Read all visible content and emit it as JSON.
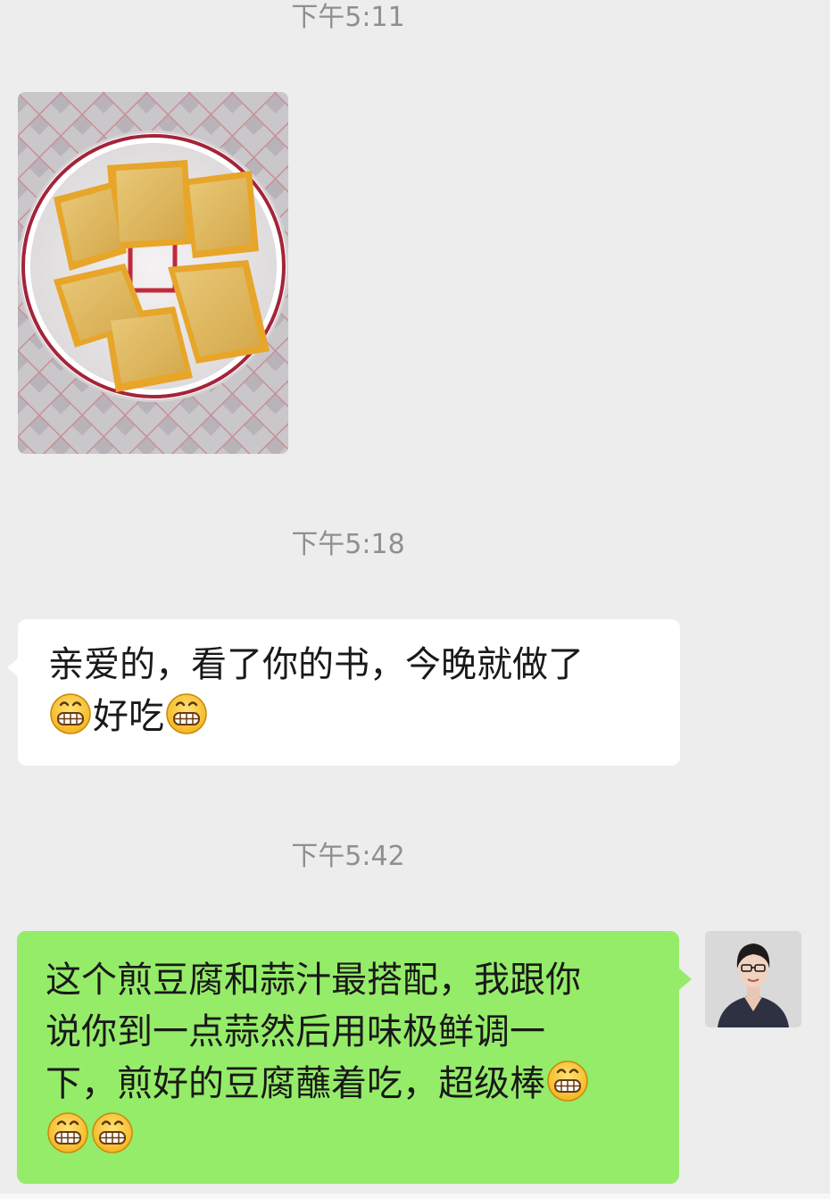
{
  "chat": {
    "timestamps": [
      "下午5:11",
      "下午5:18",
      "下午5:42"
    ],
    "messages": [
      {
        "side": "received",
        "type": "image",
        "image_label": "photo of pan-fried tofu on a plate"
      },
      {
        "side": "received",
        "type": "text",
        "line1": "亲爱的，看了你的书，今晚就做了",
        "emoji": "grin-emoji",
        "line2_text": "好吃"
      },
      {
        "side": "sent",
        "type": "text",
        "line1": "这个煎豆腐和蒜汁最搭配，我跟你",
        "line2": "说你到一点蒜然后用味极鲜调一",
        "line3_text": "下，煎好的豆腐蘸着吃，超级棒",
        "emoji": "grin-emoji"
      }
    ]
  },
  "colors": {
    "background": "#ededed",
    "sent_bubble": "#95ec69",
    "received_bubble": "#ffffff",
    "timestamp_text": "#8f8f8f"
  }
}
